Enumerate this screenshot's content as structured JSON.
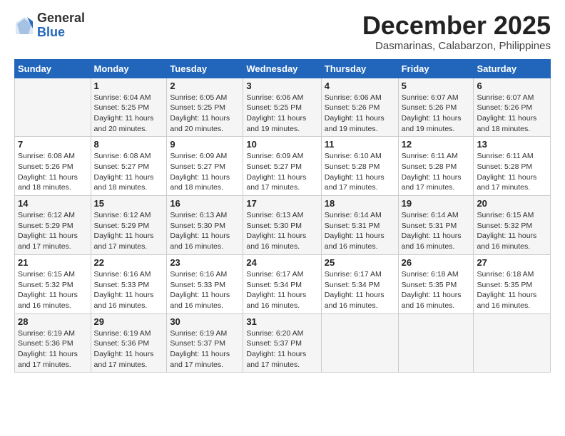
{
  "logo": {
    "general": "General",
    "blue": "Blue"
  },
  "title": {
    "month": "December 2025",
    "location": "Dasmarinas, Calabarzon, Philippines"
  },
  "headers": [
    "Sunday",
    "Monday",
    "Tuesday",
    "Wednesday",
    "Thursday",
    "Friday",
    "Saturday"
  ],
  "weeks": [
    [
      {
        "day": "",
        "info": ""
      },
      {
        "day": "1",
        "info": "Sunrise: 6:04 AM\nSunset: 5:25 PM\nDaylight: 11 hours\nand 20 minutes."
      },
      {
        "day": "2",
        "info": "Sunrise: 6:05 AM\nSunset: 5:25 PM\nDaylight: 11 hours\nand 20 minutes."
      },
      {
        "day": "3",
        "info": "Sunrise: 6:06 AM\nSunset: 5:25 PM\nDaylight: 11 hours\nand 19 minutes."
      },
      {
        "day": "4",
        "info": "Sunrise: 6:06 AM\nSunset: 5:26 PM\nDaylight: 11 hours\nand 19 minutes."
      },
      {
        "day": "5",
        "info": "Sunrise: 6:07 AM\nSunset: 5:26 PM\nDaylight: 11 hours\nand 19 minutes."
      },
      {
        "day": "6",
        "info": "Sunrise: 6:07 AM\nSunset: 5:26 PM\nDaylight: 11 hours\nand 18 minutes."
      }
    ],
    [
      {
        "day": "7",
        "info": "Sunrise: 6:08 AM\nSunset: 5:26 PM\nDaylight: 11 hours\nand 18 minutes."
      },
      {
        "day": "8",
        "info": "Sunrise: 6:08 AM\nSunset: 5:27 PM\nDaylight: 11 hours\nand 18 minutes."
      },
      {
        "day": "9",
        "info": "Sunrise: 6:09 AM\nSunset: 5:27 PM\nDaylight: 11 hours\nand 18 minutes."
      },
      {
        "day": "10",
        "info": "Sunrise: 6:09 AM\nSunset: 5:27 PM\nDaylight: 11 hours\nand 17 minutes."
      },
      {
        "day": "11",
        "info": "Sunrise: 6:10 AM\nSunset: 5:28 PM\nDaylight: 11 hours\nand 17 minutes."
      },
      {
        "day": "12",
        "info": "Sunrise: 6:11 AM\nSunset: 5:28 PM\nDaylight: 11 hours\nand 17 minutes."
      },
      {
        "day": "13",
        "info": "Sunrise: 6:11 AM\nSunset: 5:28 PM\nDaylight: 11 hours\nand 17 minutes."
      }
    ],
    [
      {
        "day": "14",
        "info": "Sunrise: 6:12 AM\nSunset: 5:29 PM\nDaylight: 11 hours\nand 17 minutes."
      },
      {
        "day": "15",
        "info": "Sunrise: 6:12 AM\nSunset: 5:29 PM\nDaylight: 11 hours\nand 17 minutes."
      },
      {
        "day": "16",
        "info": "Sunrise: 6:13 AM\nSunset: 5:30 PM\nDaylight: 11 hours\nand 16 minutes."
      },
      {
        "day": "17",
        "info": "Sunrise: 6:13 AM\nSunset: 5:30 PM\nDaylight: 11 hours\nand 16 minutes."
      },
      {
        "day": "18",
        "info": "Sunrise: 6:14 AM\nSunset: 5:31 PM\nDaylight: 11 hours\nand 16 minutes."
      },
      {
        "day": "19",
        "info": "Sunrise: 6:14 AM\nSunset: 5:31 PM\nDaylight: 11 hours\nand 16 minutes."
      },
      {
        "day": "20",
        "info": "Sunrise: 6:15 AM\nSunset: 5:32 PM\nDaylight: 11 hours\nand 16 minutes."
      }
    ],
    [
      {
        "day": "21",
        "info": "Sunrise: 6:15 AM\nSunset: 5:32 PM\nDaylight: 11 hours\nand 16 minutes."
      },
      {
        "day": "22",
        "info": "Sunrise: 6:16 AM\nSunset: 5:33 PM\nDaylight: 11 hours\nand 16 minutes."
      },
      {
        "day": "23",
        "info": "Sunrise: 6:16 AM\nSunset: 5:33 PM\nDaylight: 11 hours\nand 16 minutes."
      },
      {
        "day": "24",
        "info": "Sunrise: 6:17 AM\nSunset: 5:34 PM\nDaylight: 11 hours\nand 16 minutes."
      },
      {
        "day": "25",
        "info": "Sunrise: 6:17 AM\nSunset: 5:34 PM\nDaylight: 11 hours\nand 16 minutes."
      },
      {
        "day": "26",
        "info": "Sunrise: 6:18 AM\nSunset: 5:35 PM\nDaylight: 11 hours\nand 16 minutes."
      },
      {
        "day": "27",
        "info": "Sunrise: 6:18 AM\nSunset: 5:35 PM\nDaylight: 11 hours\nand 16 minutes."
      }
    ],
    [
      {
        "day": "28",
        "info": "Sunrise: 6:19 AM\nSunset: 5:36 PM\nDaylight: 11 hours\nand 17 minutes."
      },
      {
        "day": "29",
        "info": "Sunrise: 6:19 AM\nSunset: 5:36 PM\nDaylight: 11 hours\nand 17 minutes."
      },
      {
        "day": "30",
        "info": "Sunrise: 6:19 AM\nSunset: 5:37 PM\nDaylight: 11 hours\nand 17 minutes."
      },
      {
        "day": "31",
        "info": "Sunrise: 6:20 AM\nSunset: 5:37 PM\nDaylight: 11 hours\nand 17 minutes."
      },
      {
        "day": "",
        "info": ""
      },
      {
        "day": "",
        "info": ""
      },
      {
        "day": "",
        "info": ""
      }
    ]
  ]
}
